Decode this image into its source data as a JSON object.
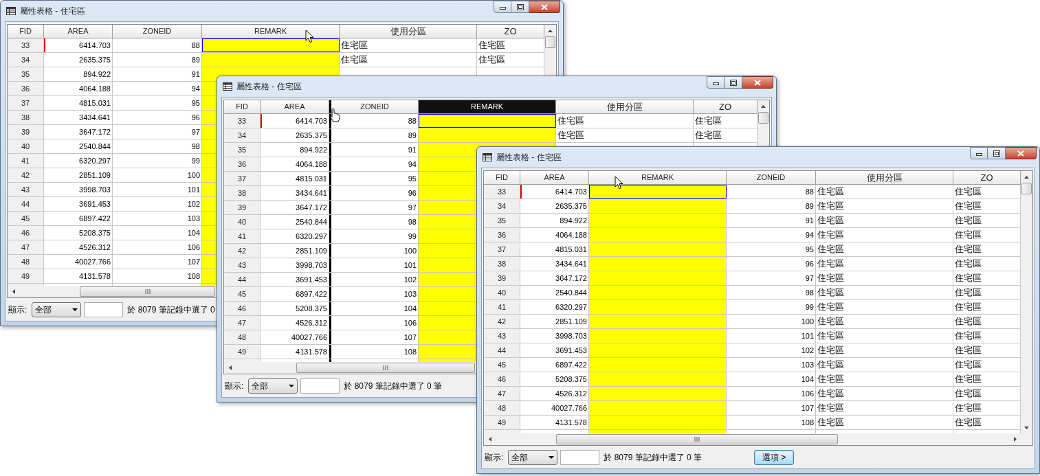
{
  "windows": [
    {
      "title": "屬性表格 - 住宅區",
      "cursor": {
        "kind": "arrow"
      },
      "columns": [
        {
          "label": "FID",
          "kind": "index",
          "selected": false,
          "drop_marker": false
        },
        {
          "label": "AREA",
          "kind": "decimal",
          "selected": false,
          "drop_marker": false
        },
        {
          "label": "ZONEID",
          "kind": "integer",
          "selected": false,
          "drop_marker": false
        },
        {
          "label": "REMARK",
          "kind": "highlight",
          "selected": false,
          "drop_marker": false
        },
        {
          "label": "使用分區",
          "kind": "text",
          "selected": false,
          "drop_marker": false
        },
        {
          "label": "ZO",
          "kind": "text",
          "selected": false,
          "drop_marker": false
        }
      ],
      "rows": [
        {
          "cells": [
            "33",
            "6414.703",
            "88",
            "住宅區",
            "住宅區"
          ],
          "current": true
        },
        {
          "cells": [
            "34",
            "2635.375",
            "89",
            "住宅區",
            "住宅區"
          ],
          "current": false
        },
        {
          "cells": [
            "35",
            "894.922",
            "91"
          ],
          "current": false
        },
        {
          "cells": [
            "36",
            "4064.188",
            "94"
          ],
          "current": false
        },
        {
          "cells": [
            "37",
            "4815.031",
            "95"
          ],
          "current": false
        },
        {
          "cells": [
            "38",
            "3434.641",
            "96"
          ],
          "current": false
        },
        {
          "cells": [
            "39",
            "3647.172",
            "97"
          ],
          "current": false
        },
        {
          "cells": [
            "40",
            "2540.844",
            "98"
          ],
          "current": false
        },
        {
          "cells": [
            "41",
            "6320.297",
            "99"
          ],
          "current": false
        },
        {
          "cells": [
            "42",
            "2851.109",
            "100"
          ],
          "current": false
        },
        {
          "cells": [
            "43",
            "3998.703",
            "101"
          ],
          "current": false
        },
        {
          "cells": [
            "44",
            "3691.453",
            "102"
          ],
          "current": false
        },
        {
          "cells": [
            "45",
            "6897.422",
            "103"
          ],
          "current": false
        },
        {
          "cells": [
            "46",
            "5208.375",
            "104"
          ],
          "current": false
        },
        {
          "cells": [
            "47",
            "4526.312",
            "106"
          ],
          "current": false
        },
        {
          "cells": [
            "48",
            "40027.766",
            "107"
          ],
          "current": false
        },
        {
          "cells": [
            "49",
            "4131.578",
            "108"
          ],
          "current": false
        }
      ],
      "status": {
        "label": "顯示:",
        "filter": "全部",
        "summary": "於 8079 筆記錄中選了 0"
      }
    },
    {
      "title": "屬性表格 - 住宅區",
      "cursor": {
        "kind": "hand"
      },
      "columns": [
        {
          "label": "FID",
          "kind": "index",
          "selected": false,
          "drop_marker": false
        },
        {
          "label": "AREA",
          "kind": "decimal",
          "selected": false,
          "drop_marker": false
        },
        {
          "label": "ZONEID",
          "kind": "integer",
          "selected": false,
          "drop_marker": true
        },
        {
          "label": "REMARK",
          "kind": "highlight",
          "selected": true,
          "drop_marker": false
        },
        {
          "label": "使用分區",
          "kind": "text",
          "selected": false,
          "drop_marker": false
        },
        {
          "label": "ZO",
          "kind": "text",
          "selected": false,
          "drop_marker": false
        }
      ],
      "rows": [
        {
          "cells": [
            "33",
            "6414.703",
            "88",
            "住宅區",
            "住宅區"
          ],
          "current": true
        },
        {
          "cells": [
            "34",
            "2635.375",
            "89",
            "住宅區",
            "住宅區"
          ],
          "current": false
        },
        {
          "cells": [
            "35",
            "894.922",
            "91"
          ],
          "current": false
        },
        {
          "cells": [
            "36",
            "4064.188",
            "94"
          ],
          "current": false
        },
        {
          "cells": [
            "37",
            "4815.031",
            "95"
          ],
          "current": false
        },
        {
          "cells": [
            "38",
            "3434.641",
            "96"
          ],
          "current": false
        },
        {
          "cells": [
            "39",
            "3647.172",
            "97"
          ],
          "current": false
        },
        {
          "cells": [
            "40",
            "2540.844",
            "98"
          ],
          "current": false
        },
        {
          "cells": [
            "41",
            "6320.297",
            "99"
          ],
          "current": false
        },
        {
          "cells": [
            "42",
            "2851.109",
            "100"
          ],
          "current": false
        },
        {
          "cells": [
            "43",
            "3998.703",
            "101"
          ],
          "current": false
        },
        {
          "cells": [
            "44",
            "3691.453",
            "102"
          ],
          "current": false
        },
        {
          "cells": [
            "45",
            "6897.422",
            "103"
          ],
          "current": false
        },
        {
          "cells": [
            "46",
            "5208.375",
            "104"
          ],
          "current": false
        },
        {
          "cells": [
            "47",
            "4526.312",
            "106"
          ],
          "current": false
        },
        {
          "cells": [
            "48",
            "40027.766",
            "107"
          ],
          "current": false
        },
        {
          "cells": [
            "49",
            "4131.578",
            "108"
          ],
          "current": false
        }
      ],
      "status": {
        "label": "顯示:",
        "filter": "全部",
        "summary": "於 8079 筆記錄中選了 0 筆"
      }
    },
    {
      "title": "屬性表格 - 住宅區",
      "cursor": {
        "kind": "arrow"
      },
      "columns": [
        {
          "label": "FID",
          "kind": "index",
          "selected": false,
          "drop_marker": false
        },
        {
          "label": "AREA",
          "kind": "decimal",
          "selected": false,
          "drop_marker": false
        },
        {
          "label": "REMARK",
          "kind": "highlight",
          "selected": false,
          "drop_marker": false
        },
        {
          "label": "ZONEID",
          "kind": "integer",
          "selected": false,
          "drop_marker": false
        },
        {
          "label": "使用分區",
          "kind": "text",
          "selected": false,
          "drop_marker": false
        },
        {
          "label": "ZO",
          "kind": "text",
          "selected": false,
          "drop_marker": false
        }
      ],
      "rows": [
        {
          "cells": [
            "33",
            "6414.703",
            "88",
            "住宅區",
            "住宅區"
          ],
          "current": true
        },
        {
          "cells": [
            "34",
            "2635.375",
            "89",
            "住宅區",
            "住宅區"
          ],
          "current": false
        },
        {
          "cells": [
            "35",
            "894.922",
            "91",
            "住宅區",
            "住宅區"
          ],
          "current": false
        },
        {
          "cells": [
            "36",
            "4064.188",
            "94",
            "住宅區",
            "住宅區"
          ],
          "current": false
        },
        {
          "cells": [
            "37",
            "4815.031",
            "95",
            "住宅區",
            "住宅區"
          ],
          "current": false
        },
        {
          "cells": [
            "38",
            "3434.641",
            "96",
            "住宅區",
            "住宅區"
          ],
          "current": false
        },
        {
          "cells": [
            "39",
            "3647.172",
            "97",
            "住宅區",
            "住宅區"
          ],
          "current": false
        },
        {
          "cells": [
            "40",
            "2540.844",
            "98",
            "住宅區",
            "住宅區"
          ],
          "current": false
        },
        {
          "cells": [
            "41",
            "6320.297",
            "99",
            "住宅區",
            "住宅區"
          ],
          "current": false
        },
        {
          "cells": [
            "42",
            "2851.109",
            "100",
            "住宅區",
            "住宅區"
          ],
          "current": false
        },
        {
          "cells": [
            "43",
            "3998.703",
            "101",
            "住宅區",
            "住宅區"
          ],
          "current": false
        },
        {
          "cells": [
            "44",
            "3691.453",
            "102",
            "住宅區",
            "住宅區"
          ],
          "current": false
        },
        {
          "cells": [
            "45",
            "6897.422",
            "103",
            "住宅區",
            "住宅區"
          ],
          "current": false
        },
        {
          "cells": [
            "46",
            "5208.375",
            "104",
            "住宅區",
            "住宅區"
          ],
          "current": false
        },
        {
          "cells": [
            "47",
            "4526.312",
            "106",
            "住宅區",
            "住宅區"
          ],
          "current": false
        },
        {
          "cells": [
            "48",
            "40027.766",
            "107",
            "住宅區",
            "住宅區"
          ],
          "current": false
        },
        {
          "cells": [
            "49",
            "4131.578",
            "108",
            "住宅區",
            "住宅區"
          ],
          "current": false
        }
      ],
      "status": {
        "label": "顯示:",
        "filter": "全部",
        "summary": "於 8079 筆記錄中選了 0 筆",
        "button": "選項 >"
      }
    }
  ]
}
